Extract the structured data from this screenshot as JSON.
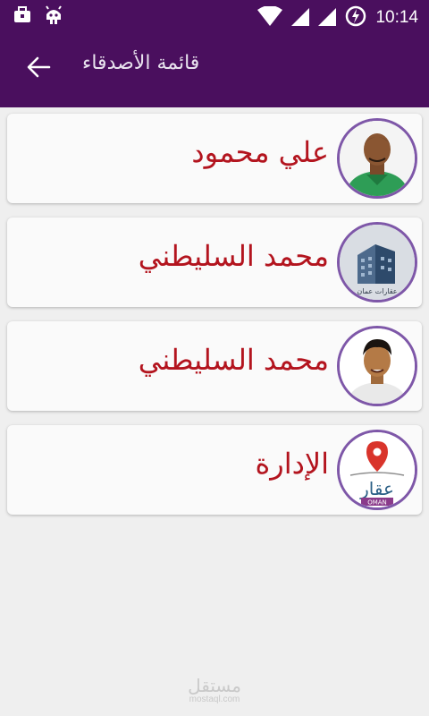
{
  "status_bar": {
    "time": "10:14",
    "icons": [
      "briefcase-icon",
      "android-icon",
      "wifi-icon",
      "signal-icon",
      "signal-icon",
      "battery-charging-icon"
    ]
  },
  "app_bar": {
    "title": "قائمة الأصدقاء",
    "back_icon": "arrow-back-icon",
    "color": "#4a0f5e"
  },
  "friends": [
    {
      "name": "علي  محمود",
      "avatar": "person-photo"
    },
    {
      "name": "محمد  السليطني",
      "avatar": "building-logo"
    },
    {
      "name": "محمد  السليطني",
      "avatar": "person-photo"
    },
    {
      "name": "الإدارة",
      "avatar": "aqar-oman-logo"
    }
  ],
  "avatar_text": {
    "building_caption": "عقارات عمان",
    "logo_word": "عقار",
    "logo_sub": "OMAN"
  },
  "watermark": {
    "main": "مستقل",
    "sub": "mostaql.com"
  },
  "colors": {
    "name_text": "#b3141e",
    "avatar_border": "#7e57a8",
    "background": "#efefef"
  }
}
